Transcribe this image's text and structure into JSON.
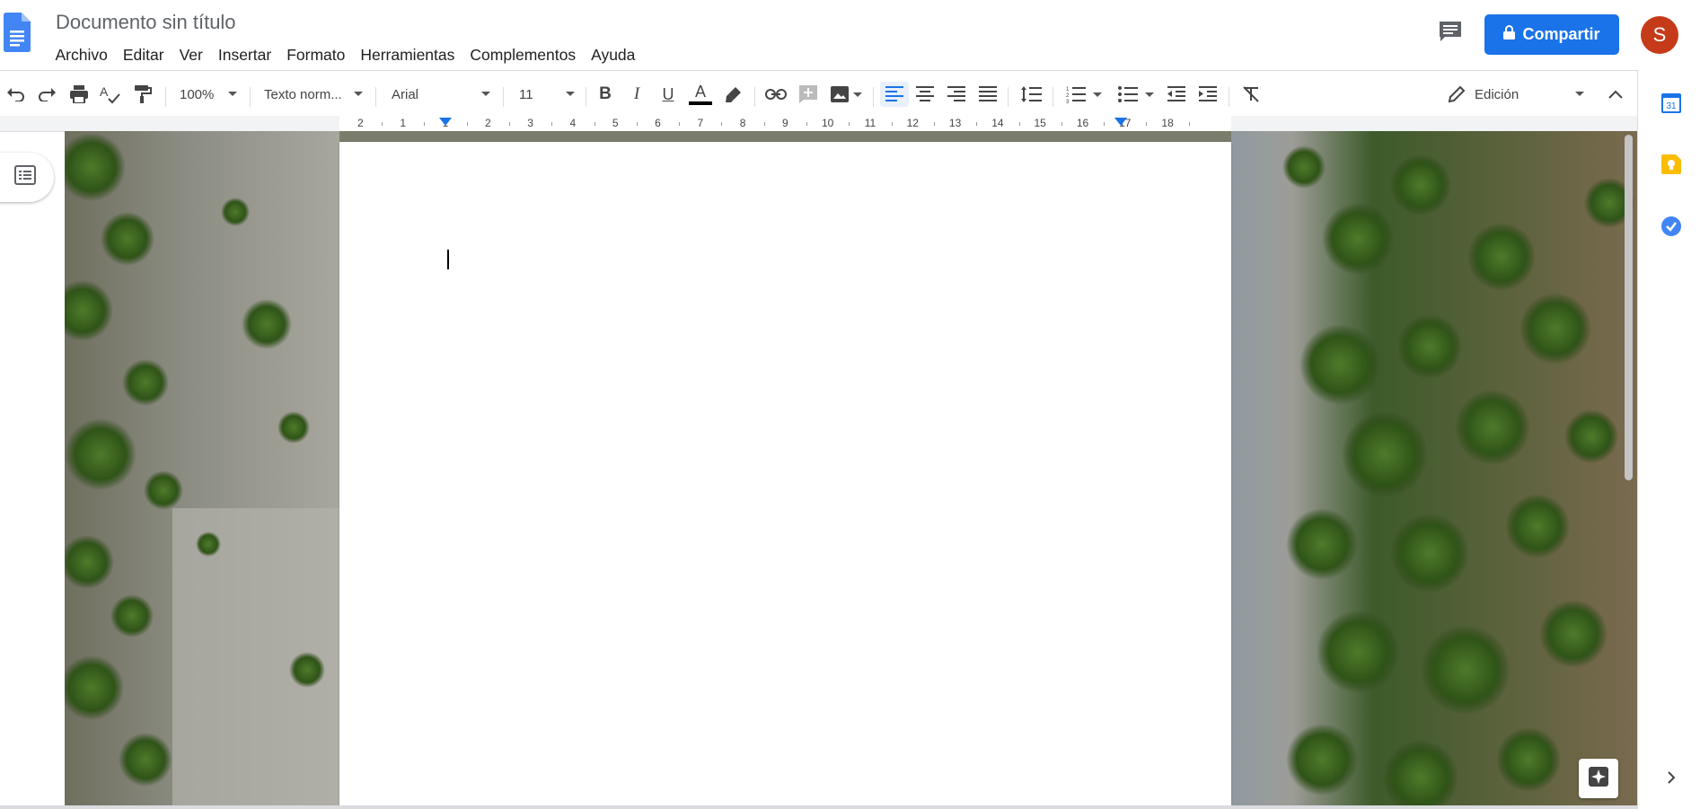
{
  "app": {
    "name": "Google Docs"
  },
  "document": {
    "title": "Documento sin título"
  },
  "menu": [
    "Archivo",
    "Editar",
    "Ver",
    "Insertar",
    "Formato",
    "Herramientas",
    "Complementos",
    "Ayuda"
  ],
  "header": {
    "share_label": "Compartir",
    "avatar_initial": "S"
  },
  "toolbar": {
    "zoom": "100%",
    "style": "Texto norm...",
    "font": "Arial",
    "font_size": "11",
    "mode": "Edición",
    "text_color": "#000000",
    "accent": "#1a73e8"
  },
  "ruler": {
    "numbers": [
      "2",
      "1",
      "1",
      "2",
      "3",
      "4",
      "5",
      "6",
      "7",
      "8",
      "9",
      "10",
      "11",
      "12",
      "13",
      "14",
      "15",
      "16",
      "17",
      "18"
    ]
  },
  "side_panel": {
    "icons": [
      "calendar-icon",
      "keep-icon",
      "tasks-icon"
    ],
    "calendar_day": "31"
  },
  "colors": {
    "share_button": "#1a73e8",
    "avatar": "#c53b1a"
  }
}
